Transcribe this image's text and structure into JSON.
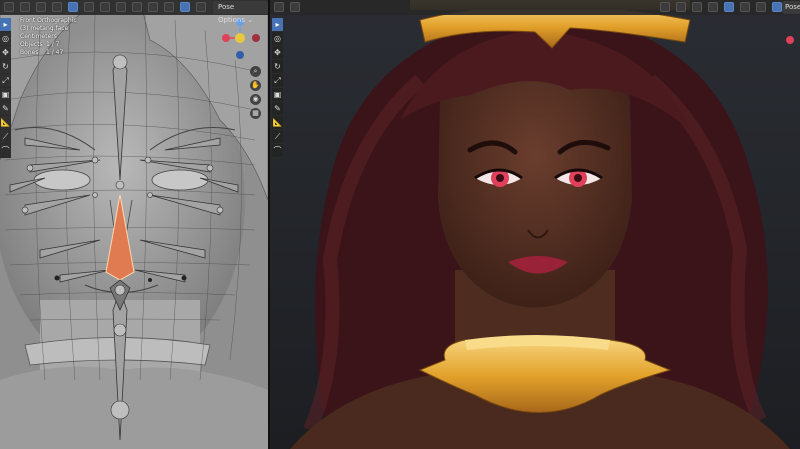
{
  "left_viewport": {
    "header": {
      "mode_menu": "Pose Options ⌄"
    },
    "overlay": {
      "view_name": "Front Orthographic",
      "collection": "(3) metang.face",
      "units": "Centimeters",
      "objects_label": "Objects",
      "objects_value": "1 / 7",
      "bones_label": "Bones",
      "bones_value": "1 / 47"
    }
  },
  "right_viewport": {
    "header": {
      "mode_menu": "Pose"
    }
  },
  "colors": {
    "skin": "#5b3426",
    "hair": "#3a1418",
    "gold": "#e2a12a",
    "eye": "#e0405a",
    "selection": "#e07a50"
  }
}
